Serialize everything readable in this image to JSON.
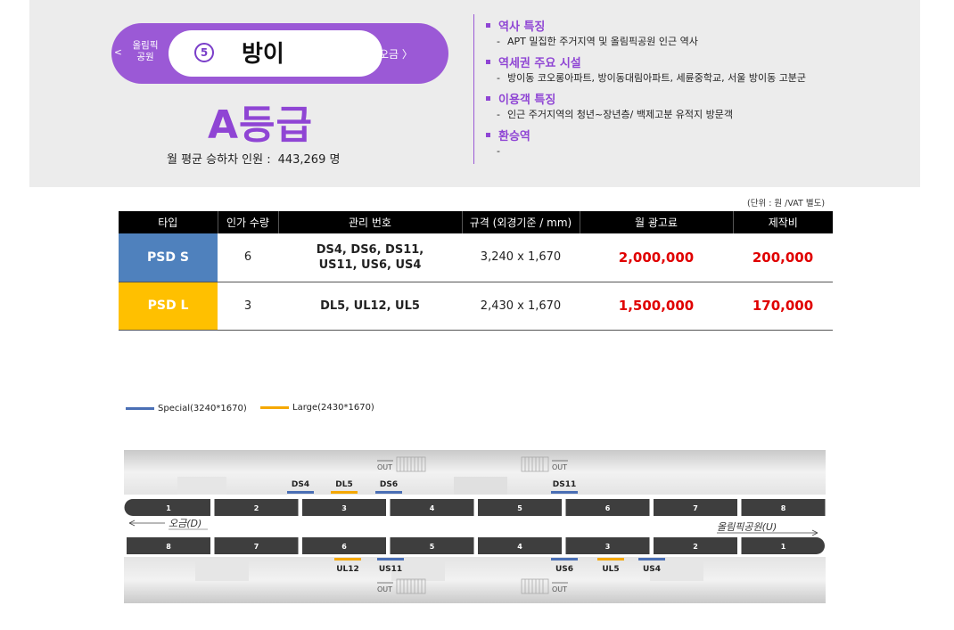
{
  "header": {
    "prev_station": "올림픽\n공원",
    "prev_arrow": "<",
    "next_station": "오금 〉",
    "station_number": "5",
    "station_name": "방이",
    "grade": "A등급",
    "monthly_label": "월 평균 승하차 인원 :",
    "monthly_value": "443,269 명",
    "colors": {
      "accent": "#9b59d6",
      "grade": "#8f45d4"
    }
  },
  "info": [
    {
      "title": "역사 특징",
      "text": "APT 밀집한 주거지역  및 올림픽공원 인근 역사"
    },
    {
      "title": "역세권 주요 시설",
      "text": "방이동 코오롱아파트, 방이동대림아파트, 세륜중학교, 서울 방이동 고분군"
    },
    {
      "title": "이용객 특징",
      "text": "인근 주거지역의 청년~장년층/ 백제고분 유적지 방문객"
    },
    {
      "title": "환승역",
      "text": ""
    }
  ],
  "table": {
    "unit_note": "(단위 : 원 /VAT 별도)",
    "headers": [
      "타입",
      "인가 수량",
      "관리 번호",
      "규격 (외경기준 / mm)",
      "월 광고료",
      "제작비"
    ],
    "rows": [
      {
        "type": "PSD S",
        "color": "#4f81bd",
        "qty": "6",
        "codes1": "DS4, DS6, DS11,",
        "codes2": "US11, US6, US4",
        "size": "3,240 x 1,670",
        "fee": "2,000,000",
        "prod": "200,000"
      },
      {
        "type": "PSD L",
        "color": "#ffc000",
        "qty": "3",
        "codes1": "DL5, UL12, UL5",
        "codes2": "",
        "size": "2,430 x 1,670",
        "fee": "1,500,000",
        "prod": "170,000"
      }
    ]
  },
  "legend": [
    {
      "label": "Special(3240*1670)",
      "color": "#4a6fb5"
    },
    {
      "label": "Large(2430*1670)",
      "color": "#f5a800"
    }
  ],
  "diagram": {
    "top_cars": [
      "1",
      "2",
      "3",
      "4",
      "5",
      "6",
      "7",
      "8"
    ],
    "bottom_cars": [
      "8",
      "7",
      "6",
      "5",
      "4",
      "3",
      "2",
      "1"
    ],
    "direction_left": "오금(D)",
    "direction_right": "올림픽공원(U)",
    "out_label": "OUT",
    "top_markers": [
      {
        "label": "DS4",
        "type": "special"
      },
      {
        "label": "DL5",
        "type": "large"
      },
      {
        "label": "DS6",
        "type": "special"
      },
      {
        "label": "DS11",
        "type": "special"
      }
    ],
    "bottom_markers": [
      {
        "label": "UL12",
        "type": "large"
      },
      {
        "label": "US11",
        "type": "special"
      },
      {
        "label": "US6",
        "type": "special"
      },
      {
        "label": "UL5",
        "type": "large"
      },
      {
        "label": "US4",
        "type": "special"
      }
    ]
  }
}
